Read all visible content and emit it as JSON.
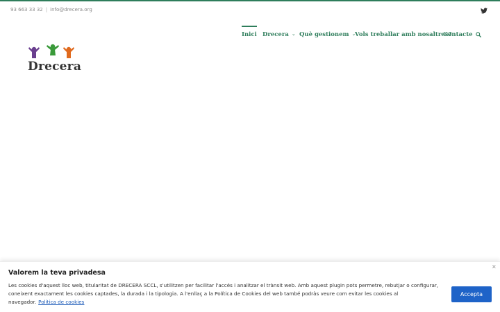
{
  "topbar": {
    "phone": "93 663 33 32",
    "separator": "|",
    "email": "info@drecera.org"
  },
  "brand": {
    "name": "Drecera",
    "colors": {
      "accent": "#2e7d5b",
      "purple": "#6a3f8f",
      "green": "#3a9a3a",
      "orange": "#e06a1e"
    }
  },
  "nav": {
    "items": [
      {
        "label": "Inici",
        "active": true
      },
      {
        "label": "Drecera",
        "has_dropdown": true
      },
      {
        "label": "Què gestionem",
        "has_dropdown": true
      },
      {
        "label": "Vols treballar amb nosaltres?"
      },
      {
        "label": "Contacte"
      }
    ],
    "chevron": "⌄"
  },
  "icons": [
    "twitter-icon",
    "search-icon",
    "close-icon"
  ],
  "cookie": {
    "title": "Valorem la teva privadesa",
    "text": "Les cookies d'aquest lloc web, titularitat de DRECERA SCCL, s'utilitzen per facilitar l'accés i analitzar el trànsit web. Amb aquest plugin pots permetre, rebutjar o configurar, coneixent exactament les cookies captades, la durada i la tipologia. A l'enllaç a la Política de Cookies del web també podràs veure com evitar les cookies al navegador.",
    "link_label": "Política de cookies",
    "accept_label": "Accepta",
    "close_glyph": "×"
  }
}
